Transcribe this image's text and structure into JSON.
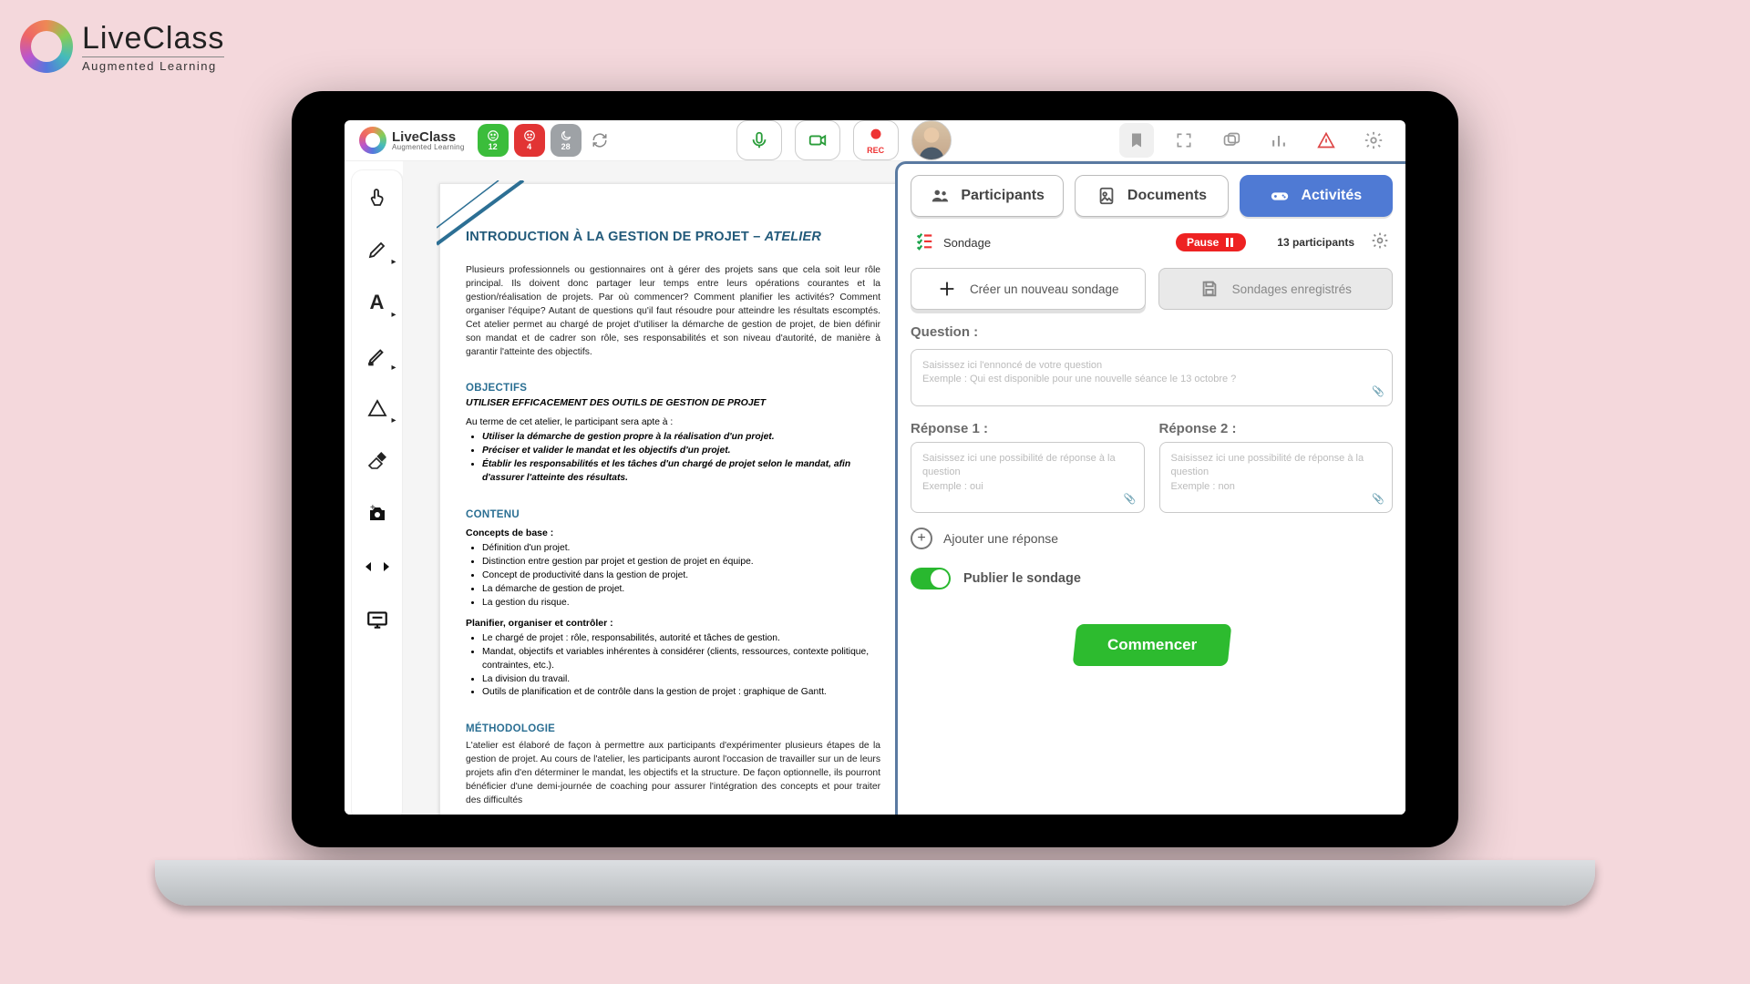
{
  "brand": {
    "name": "LiveClass",
    "tagline": "Augmented Learning"
  },
  "topbar": {
    "status_pills": {
      "green": "12",
      "red": "4",
      "grey": "28"
    },
    "rec_label": "REC"
  },
  "sidepanel": {
    "tabs": {
      "participants": "Participants",
      "documents": "Documents",
      "activities": "Activités"
    },
    "sondage": {
      "label": "Sondage",
      "pause": "Pause",
      "participants": "13 participants"
    },
    "create_new": "Créer un nouveau sondage",
    "saved": "Sondages enregistrés",
    "question_label": "Question :",
    "question_placeholder": "Saisissez ici l'ennoncé de votre question\nExemple : Qui est disponible pour une nouvelle séance le 13 octobre ?",
    "answer1_label": "Réponse 1 :",
    "answer1_placeholder": "Saisissez ici une possibilité de réponse à la question\nExemple : oui",
    "answer2_label": "Réponse 2 :",
    "answer2_placeholder": "Saisissez ici une possibilité de réponse à la question\nExemple : non",
    "add_answer": "Ajouter une réponse",
    "publish": "Publier le sondage",
    "start": "Commencer"
  },
  "doc": {
    "title_main": "INTRODUCTION À LA GESTION DE PROJET – ",
    "title_sub": "ATELIER",
    "intro": "Plusieurs professionnels ou gestionnaires ont à gérer des projets sans que cela soit leur rôle principal. Ils doivent donc partager leur temps entre leurs opérations courantes et la gestion/réalisation de projets. Par où commencer? Comment planifier les activités? Comment organiser l'équipe? Autant de questions qu'il faut résoudre pour atteindre les résultats escomptés. Cet atelier permet au chargé de projet d'utiliser la démarche de gestion de projet, de bien définir son mandat et de cadrer son rôle, ses responsabilités et son niveau d'autorité, de manière à garantir l'atteinte des objectifs.",
    "h_objectifs": "OBJECTIFS",
    "subline": "UTILISER EFFICACEMENT DES OUTILS DE GESTION DE PROJET",
    "lead_in": "Au terme de cet atelier, le participant sera apte à :",
    "objectifs": [
      "Utiliser la démarche de gestion propre à la réalisation d'un projet.",
      "Préciser et valider le mandat et les objectifs d'un projet.",
      "Établir les responsabilités et les tâches d'un chargé de projet selon le mandat, afin d'assurer l'atteinte des résultats."
    ],
    "h_contenu": "CONTENU",
    "sub_concepts": "Concepts de base :",
    "concepts": [
      "Définition d'un projet.",
      "Distinction entre gestion par projet et gestion de projet en équipe.",
      "Concept de productivité dans la gestion de projet.",
      "La démarche de gestion de projet.",
      "La gestion du risque."
    ],
    "sub_plan": "Planifier, organiser et contrôler :",
    "plan": [
      "Le chargé de projet : rôle, responsabilités, autorité et tâches de gestion.",
      "Mandat, objectifs et variables inhérentes à considérer (clients, ressources, contexte politique, contraintes, etc.).",
      "La division du travail.",
      "Outils de planification et de contrôle dans la gestion de projet : graphique de Gantt."
    ],
    "h_methodo": "MÉTHODOLOGIE",
    "methodo": "L'atelier est élaboré de façon à permettre aux participants d'expérimenter plusieurs étapes de la gestion de projet. Au cours de l'atelier, les participants auront l'occasion de travailler sur un de leurs projets afin d'en déterminer le mandat, les objectifs et la structure. De façon optionnelle, ils pourront bénéficier d'une demi-journée de coaching pour assurer l'intégration des concepts et pour traiter des difficultés"
  }
}
